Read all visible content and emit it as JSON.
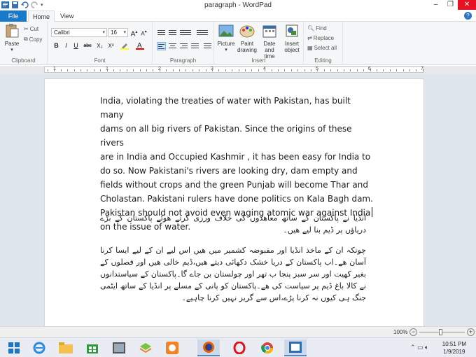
{
  "window": {
    "title": "paragraph - WordPad",
    "minimize": "–",
    "maximize": "❐",
    "close": "✕"
  },
  "tabs": {
    "file": "File",
    "home": "Home",
    "view": "View",
    "help": "?"
  },
  "ribbon": {
    "clipboard": {
      "label": "Clipboard",
      "paste": "Paste",
      "cut": "Cut",
      "copy": "Copy"
    },
    "font": {
      "label": "Font",
      "family": "Calibri",
      "size": "16",
      "bold": "B",
      "italic": "I",
      "underline": "U",
      "strike": "abc",
      "subscript": "X₂",
      "superscript": "X²"
    },
    "paragraph": {
      "label": "Paragraph"
    },
    "insert": {
      "label": "Insert",
      "picture": "Picture",
      "paint_drawing": "Paint drawing",
      "date_time": "Date and time",
      "insert_object": "Insert object"
    },
    "editing": {
      "label": "Editing",
      "find": "Find",
      "replace": "Replace",
      "select_all": "Select all"
    }
  },
  "ruler": {
    "numbers": [
      "1",
      "1",
      "2",
      "3",
      "4",
      "5",
      "6",
      "7"
    ]
  },
  "document": {
    "english_lines": [
      "India, violating the treaties of water with Pakistan, has built many",
      "dams on all big rivers of Pakistan. Since the origins of these rivers",
      "are in India and Occupied Kashmir , it has been easy for India to",
      "do so. Now Pakistani's rivers are looking dry, dam empty and",
      "fields without crops and the green Punjab will become Thar and",
      "Cholastan. Pakistani rulers have done politics on Kala Bagh dam.",
      "Pakistan should not avoid even waging atomic war against India",
      "on the issue of water."
    ],
    "urdu_para_1": "انڈیا نے پاکستان کے ساتھ معاھدوں کی خلاف ورزی کرتے ھوئے پاکستان کے بڑے دریاؤں پر ڈیم بنا لیے ھیں۔",
    "urdu_para_2": "چونکہ ان کے ماخذ انڈیا اور مقبوضہ کشمیر میں ھیں اس لیے ان کے لیے ایسا کرنا آسان ھے۔اب پاکستان کے دریا خشک دکھائی دیتے ھیں،ڈیم خالی ھیں اور فصلوں کے بغیر کھیت اور سر سبز پنجا ب تھر اور چولستان بن جاے گا۔پاکستان کے سیاستدانوں نے کالا باغ ڈیم پر سیاست کی ھے۔پاکستان کو پانی کے مسلے پر انڈیا کے ساتھ ایٹمی جنگ ہی کیوں نہ کرنا پڑے،اس سے گریز نہیں کرنا چاہیے۔"
  },
  "status": {
    "zoom": "100%",
    "zoom_level": 0.45
  },
  "taskbar": {
    "time": "10:51 PM",
    "date": "1/9/2019"
  },
  "colors": {
    "file_tab": "#1979ca",
    "close": "#e81123",
    "doc_bg": "#dfe6ee"
  }
}
